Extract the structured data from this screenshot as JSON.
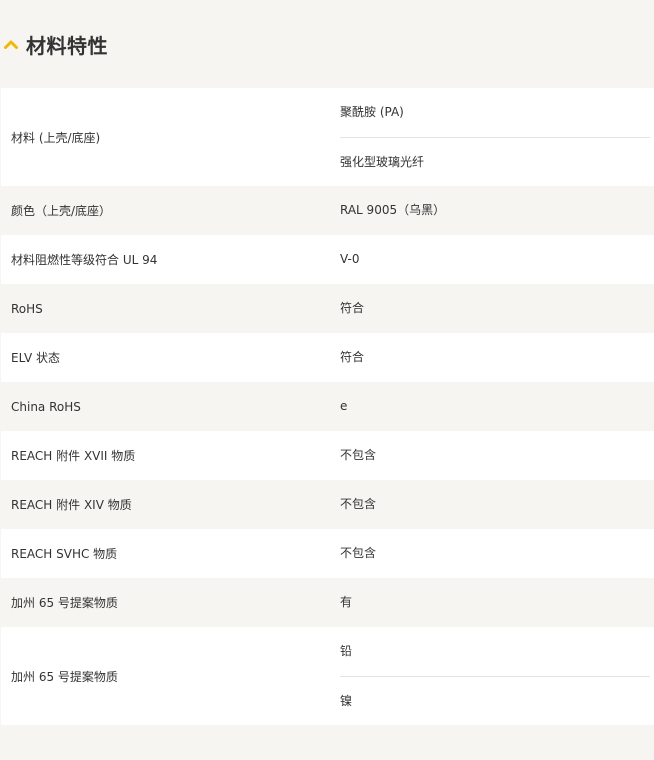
{
  "section": {
    "title": "材料特性",
    "icon": "chevron-up-icon",
    "accent_color": "#f2b705"
  },
  "properties": [
    {
      "label": "材料 (上壳/底座)",
      "values": [
        "聚酰胺 (PA)",
        "强化型玻璃光纤"
      ]
    },
    {
      "label": "颜色（上壳/底座）",
      "values": [
        "RAL 9005（乌黑）"
      ]
    },
    {
      "label": "材料阻燃性等级符合 UL 94",
      "values": [
        "V-0"
      ]
    },
    {
      "label": "RoHS",
      "values": [
        "符合"
      ]
    },
    {
      "label": "ELV 状态",
      "values": [
        "符合"
      ]
    },
    {
      "label": "China RoHS",
      "values": [
        "e"
      ]
    },
    {
      "label": "REACH 附件 XVII 物质",
      "values": [
        "不包含"
      ]
    },
    {
      "label": "REACH 附件 XIV 物质",
      "values": [
        "不包含"
      ]
    },
    {
      "label": "REACH SVHC 物质",
      "values": [
        "不包含"
      ]
    },
    {
      "label": "加州 65 号提案物质",
      "values": [
        "有"
      ]
    },
    {
      "label": "加州 65 号提案物质",
      "values": [
        "铅",
        "镍"
      ]
    }
  ]
}
